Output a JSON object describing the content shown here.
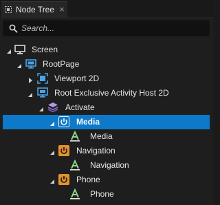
{
  "panel": {
    "title": "Node Tree",
    "close_glyph": "×"
  },
  "search": {
    "placeholder": "Search..."
  },
  "tree": {
    "nodes": [
      {
        "label": "Screen",
        "icon": "screen-icon",
        "expanded": true
      },
      {
        "label": "RootPage",
        "icon": "page-icon",
        "expanded": true
      },
      {
        "label": "Viewport 2D",
        "icon": "viewport-icon",
        "expanded": false
      },
      {
        "label": "Root Exclusive Activity Host 2D",
        "icon": "activity-host-icon",
        "expanded": true
      },
      {
        "label": "Activate",
        "icon": "state-layers-icon",
        "expanded": true
      },
      {
        "label": "Media",
        "icon": "power-activity-icon",
        "expanded": true,
        "selected": true
      },
      {
        "label": "Media",
        "icon": "text-block-icon"
      },
      {
        "label": "Navigation",
        "icon": "power-activity-icon",
        "expanded": true
      },
      {
        "label": "Navigation",
        "icon": "text-block-icon"
      },
      {
        "label": "Phone",
        "icon": "power-activity-icon",
        "expanded": true
      },
      {
        "label": "Phone",
        "icon": "text-block-icon"
      }
    ]
  },
  "colors": {
    "panel_bg": "#1e1e1e",
    "selection": "#0d79c8",
    "screen_icon": "#d9d9d9",
    "page_icon": "#4aa3e8",
    "activity_orange": "#e5922b",
    "activity_white": "#f0f0f0",
    "layers_purple": "#a58ad8",
    "text_icon": "#8fd58a"
  }
}
